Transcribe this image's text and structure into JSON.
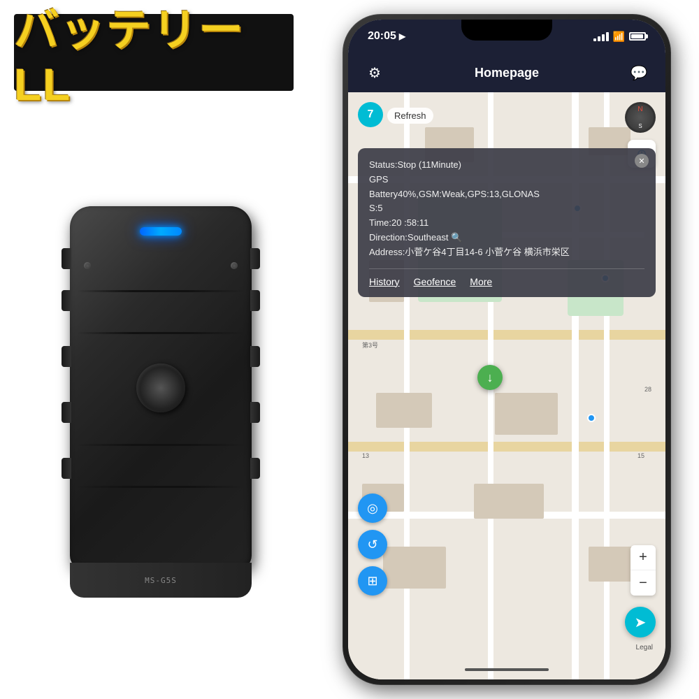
{
  "title": {
    "text": "バッテリーLL",
    "background": "#111111"
  },
  "phone": {
    "status_bar": {
      "time": "20:05",
      "nav_icon": "▶"
    },
    "header": {
      "title": "Homepage",
      "settings_icon": "gear",
      "chat_icon": "chat"
    },
    "map": {
      "refresh_count": "7",
      "refresh_label": "Refresh",
      "popup": {
        "status": "Status:Stop (11Minute)",
        "gps": "GPS",
        "battery_info": "Battery40%,GSM:Weak,GPS:13,GLONAS",
        "glonas_cont": "S:5",
        "time": "Time:20          :58:11",
        "direction": "Direction:Southeast",
        "address": "Address:小菅ケ谷4丁目14-6 小菅ケ谷 横浜市栄区",
        "action_history": "History",
        "action_geofence": "Geofence",
        "action_more": "More"
      },
      "legal": "Legal"
    }
  }
}
